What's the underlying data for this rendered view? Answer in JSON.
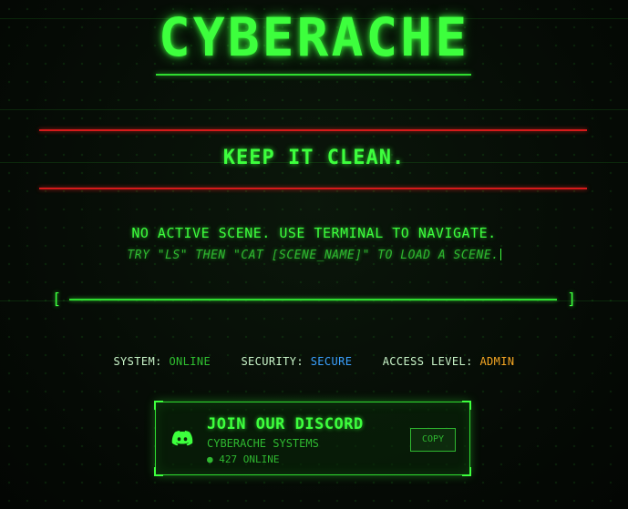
{
  "header": {
    "title": "CYBERACHE"
  },
  "banner": {
    "tagline": "KEEP IT CLEAN."
  },
  "terminal": {
    "message": "NO ACTIVE SCENE. USE TERMINAL TO NAVIGATE.",
    "hint": "TRY \"LS\" THEN \"CAT [SCENE_NAME]\" TO LOAD A SCENE."
  },
  "progress": {
    "left_bracket": "[",
    "right_bracket": "]"
  },
  "status": {
    "system_label": "SYSTEM:",
    "system_value": "ONLINE",
    "security_label": "SECURITY:",
    "security_value": "SECURE",
    "access_label": "ACCESS LEVEL:",
    "access_value": "ADMIN"
  },
  "discord": {
    "icon": "discord-icon",
    "title": "JOIN OUR DISCORD",
    "server": "CYBERACHE SYSTEMS",
    "online_count": "● 427 ONLINE",
    "copy_label": "COPY"
  },
  "colors": {
    "primary": "#3dff3d",
    "alert": "#d61a1a",
    "secure": "#3aa0ff",
    "admin": "#f5a623",
    "background": "#050a05"
  }
}
